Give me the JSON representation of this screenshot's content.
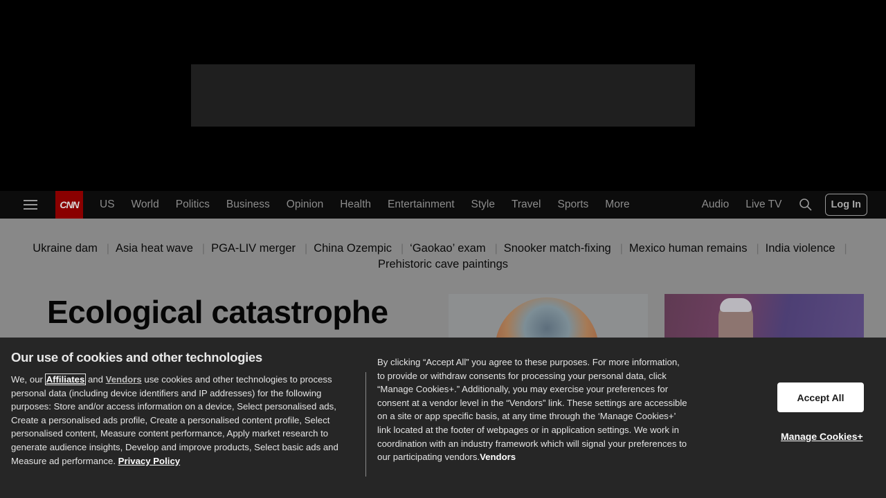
{
  "header": {
    "logo_text": "CNN",
    "nav": [
      "US",
      "World",
      "Politics",
      "Business",
      "Opinion",
      "Health",
      "Entertainment",
      "Style",
      "Travel",
      "Sports",
      "More"
    ],
    "audio_label": "Audio",
    "live_tv_label": "Live TV",
    "login_label": "Log In"
  },
  "trending": [
    "Ukraine dam",
    "Asia heat wave",
    "PGA-LIV merger",
    "China Ozempic",
    "‘Gaokao’ exam",
    "Snooker match-fixing",
    "Mexico human remains",
    "India violence",
    "Prehistoric cave paintings"
  ],
  "headline": "Ecological catastrophe",
  "cookie": {
    "title": "Our use of cookies and other technologies",
    "left_we_our": "We, our ",
    "affiliates": "Affiliates",
    "and": " and ",
    "vendors": "Vendors",
    "left_body": " use cookies and other technologies to process personal data (including device identifiers and IP addresses) for the following purposes: Store and/or access information on a device, Select personalised ads, Create a personalised ads profile, Create a personalised content profile, Select personalised content, Measure content performance, Apply market research to generate audience insights, Develop and improve products, Select basic ads and Measure ad performance. ",
    "privacy_policy": "Privacy Policy",
    "mid_body": "By clicking “Accept All” you agree to these purposes. For more information, to provide or withdraw consents for processing your personal data, click “Manage Cookies+.” Additionally, you may exercise your preferences for consent at a vendor level in the “Vendors” link. These settings are accessible on a site or app specific basis, at any time through the ‘Manage Cookies+’ link located at the footer of webpages or in application settings. We work in coordination with an industry framework which will signal your preferences to our participating vendors.",
    "mid_vendors_link": "Vendors",
    "accept_all": "Accept All",
    "manage_cookies": "Manage Cookies+"
  }
}
